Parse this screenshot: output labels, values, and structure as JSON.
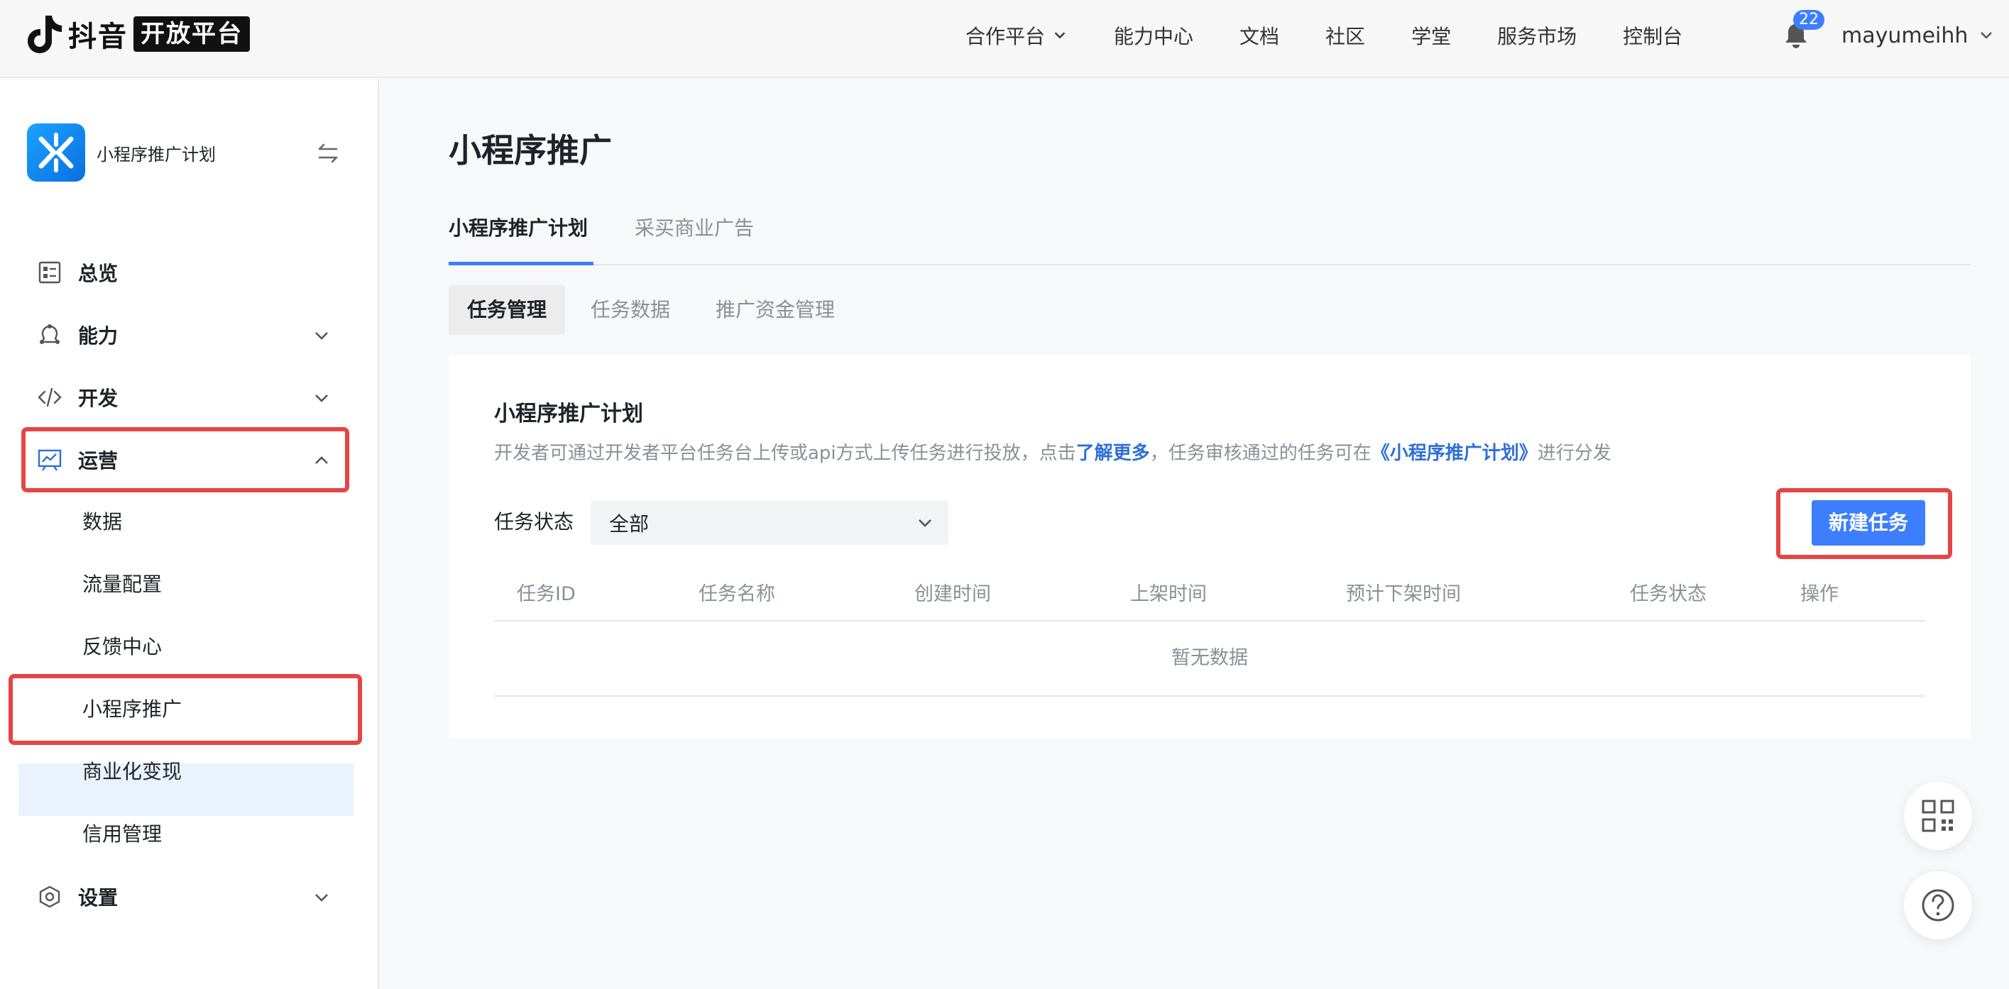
{
  "header": {
    "logo_text": "抖音",
    "logo_badge": "开放平台",
    "nav": [
      "合作平台",
      "能力中心",
      "文档",
      "社区",
      "学堂",
      "服务市场",
      "控制台"
    ],
    "notification_count": "22",
    "username": "mayumeihh"
  },
  "sidebar": {
    "app_name": "小程序推广计划",
    "menu": {
      "overview": "总览",
      "capability": "能力",
      "develop": "开发",
      "operate": "运营",
      "settings": "设置"
    },
    "operate_sub": [
      "数据",
      "流量配置",
      "反馈中心",
      "小程序推广",
      "商业化变现",
      "信用管理"
    ]
  },
  "main": {
    "title": "小程序推广",
    "tabs": [
      "小程序推广计划",
      "采买商业广告"
    ],
    "subtabs": [
      "任务管理",
      "任务数据",
      "推广资金管理"
    ],
    "card": {
      "title": "小程序推广计划",
      "desc_1": "开发者可通过开发者平台任务台上传或api方式上传任务进行投放，点击",
      "desc_link_1": "了解更多",
      "desc_2": "，任务审核通过的任务可在",
      "desc_link_2": "《小程序推广计划》",
      "desc_3": "进行分发",
      "filter_label": "任务状态",
      "filter_value": "全部",
      "new_button": "新建任务",
      "columns": [
        "任务ID",
        "任务名称",
        "创建时间",
        "上架时间",
        "预计下架时间",
        "任务状态",
        "操作"
      ],
      "empty_text": "暂无数据"
    }
  },
  "colors": {
    "accent": "#3d7eff",
    "highlight_border": "#e54545",
    "active_bg": "#eaf3fd"
  }
}
